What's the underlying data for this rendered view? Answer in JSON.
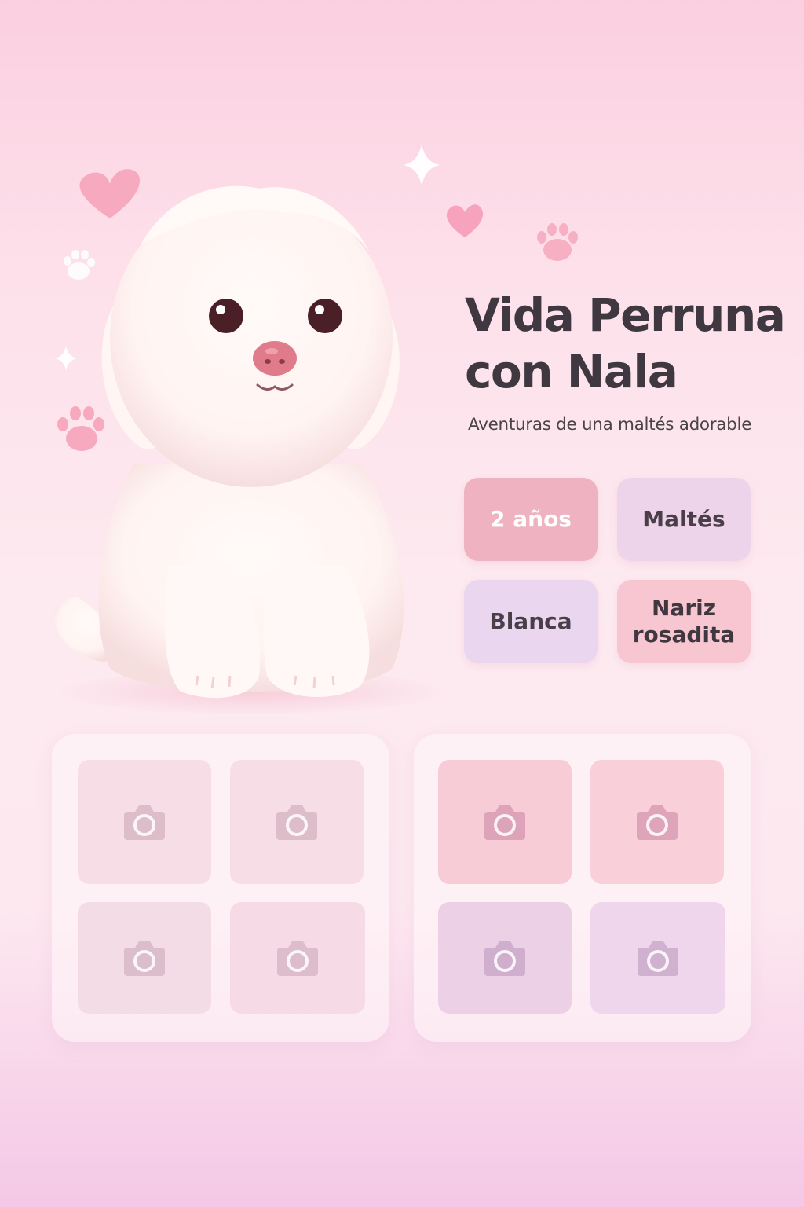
{
  "profile": {
    "title_line1": "Vida Perruna",
    "title_line2": "con Nala",
    "subtitle": "Aventuras de una maltés adorable"
  },
  "chips": [
    {
      "label": "2 años",
      "bg": "#eeb2c0",
      "fg": "#ffffff"
    },
    {
      "label": "Maltés",
      "bg": "#eed4ea",
      "fg": "#4a3f48"
    },
    {
      "label": "Blanca",
      "bg": "#ead6ee",
      "fg": "#4a3f48"
    },
    {
      "label": "Nariz\nrosadita",
      "bg": "#f8c6d0",
      "fg": "#3f3840"
    }
  ],
  "gallery": {
    "left_slots": [
      {
        "icon": "camera-icon",
        "bg": "#f7dde6"
      },
      {
        "icon": "camera-icon",
        "bg": "#f7dde6"
      },
      {
        "icon": "camera-icon",
        "bg": "#f4dce6"
      },
      {
        "icon": "camera-icon",
        "bg": "#f6dbe6"
      }
    ],
    "right_slots": [
      {
        "icon": "camera-icon",
        "bg": "#f7ccd6"
      },
      {
        "icon": "camera-icon",
        "bg": "#f9d0da"
      },
      {
        "icon": "camera-icon",
        "bg": "#ecd0e6"
      },
      {
        "icon": "camera-icon",
        "bg": "#efd6ec"
      }
    ]
  },
  "colors": {
    "accent_pink": "#f4a6bf",
    "heart_pink": "#f7a9c0",
    "paw_pink": "#f6a8bd",
    "title_dark": "#3f3840"
  }
}
